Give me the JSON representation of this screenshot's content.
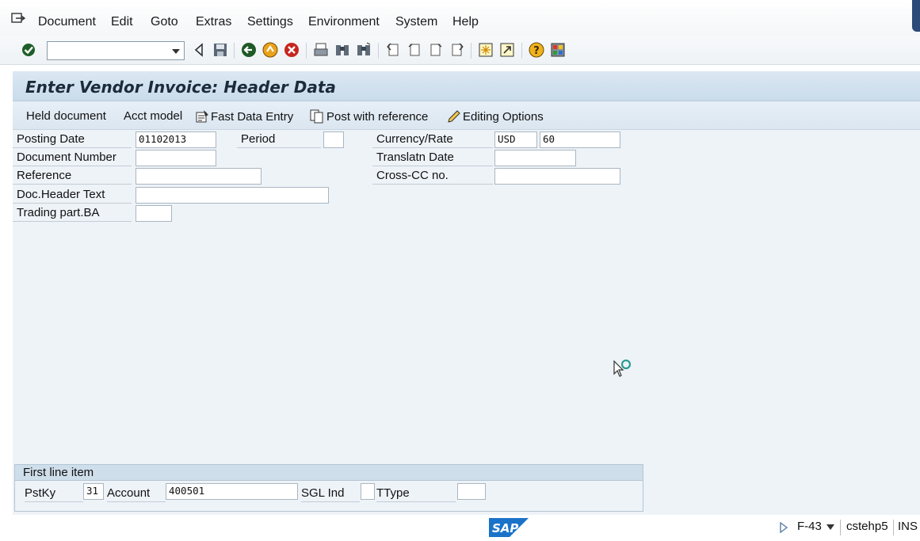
{
  "menubar": {
    "items": [
      "Document",
      "Edit",
      "Goto",
      "Extras",
      "Settings",
      "Environment",
      "System",
      "Help"
    ]
  },
  "toolbar": {
    "command_value": "",
    "icons": [
      "enter-icon",
      "back-icon",
      "save-icon",
      "back-green-icon",
      "exit-icon",
      "cancel-icon",
      "print-icon",
      "find-icon",
      "find-next-icon",
      "first-page-icon",
      "previous-page-icon",
      "next-page-icon",
      "last-page-icon",
      "new-session-icon",
      "shortcut-icon",
      "help-icon",
      "layout-icon"
    ]
  },
  "page": {
    "title": "Enter Vendor Invoice: Header Data"
  },
  "appbar": {
    "held_document": "Held document",
    "acct_model": "Acct model",
    "fast_data_entry": "Fast Data Entry",
    "post_with_reference": "Post with reference",
    "editing_options": "Editing Options"
  },
  "form": {
    "posting_date_label": "Posting Date",
    "posting_date_value": "01102013",
    "period_label": "Period",
    "period_value": "",
    "document_number_label": "Document Number",
    "document_number_value": "",
    "reference_label": "Reference",
    "reference_value": "",
    "doc_header_text_label": "Doc.Header Text",
    "doc_header_text_value": "",
    "trading_part_label": "Trading part.BA",
    "trading_part_value": "",
    "currency_rate_label": "Currency/Rate",
    "currency_value": "USD",
    "rate_value": "60",
    "translatn_date_label": "Translatn Date",
    "translatn_date_value": "",
    "cross_cc_label": "Cross-CC no.",
    "cross_cc_value": ""
  },
  "first_line_item": {
    "header": "First line item",
    "pstky_label": "PstKy",
    "pstky_value": "31",
    "account_label": "Account",
    "account_value": "400501",
    "sgl_ind_label": "SGL Ind",
    "sgl_ind_value": "",
    "ttype_label": "TType",
    "ttype_value": ""
  },
  "statusbar": {
    "transaction": "F-43",
    "server": "cstehp5",
    "mode": "INS"
  },
  "colors": {
    "title_bg": "#c9dbea",
    "panel_bg": "#eef3f8",
    "sap_blue": "#1a73c8"
  }
}
